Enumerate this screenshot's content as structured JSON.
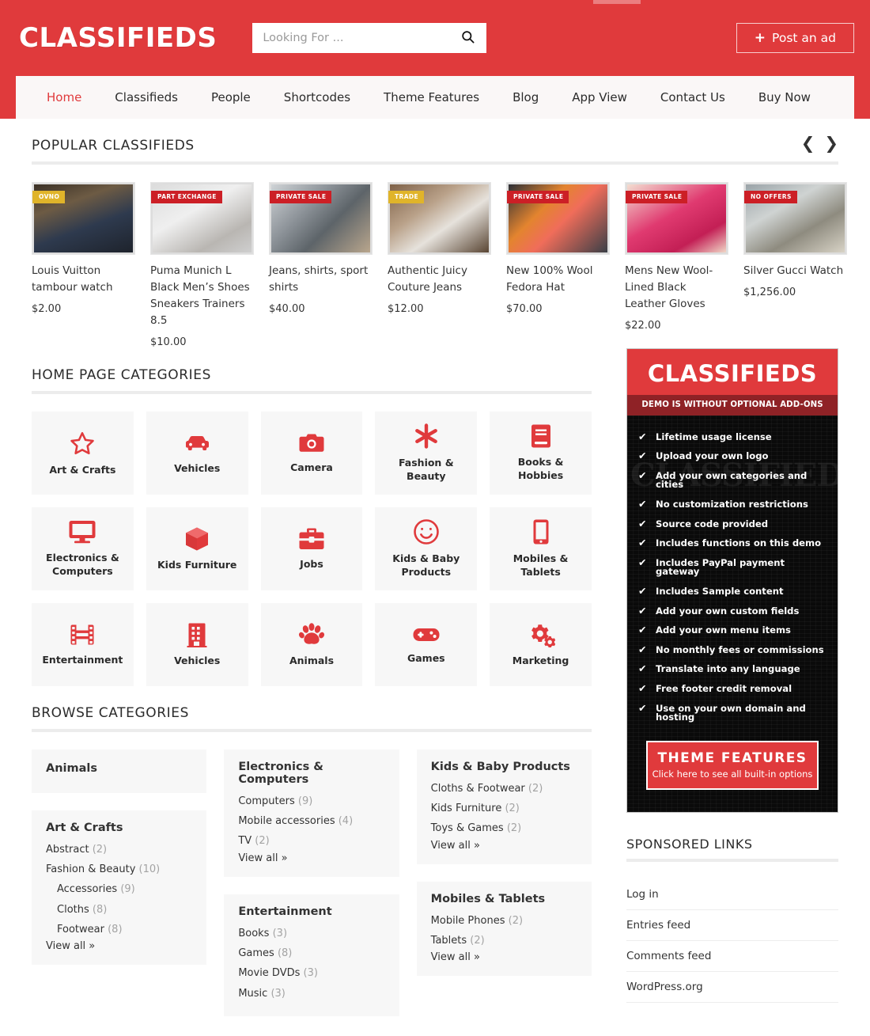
{
  "header": {
    "logo": "CLASSIFIEDS",
    "search": {
      "value": "",
      "placeholder": "Looking For ..."
    },
    "post_ad_label": "Post an ad",
    "post_ad_plus": "+",
    "accent_color": "#e03a3c"
  },
  "nav": {
    "items": [
      {
        "label": "Home",
        "active": true
      },
      {
        "label": "Classifieds",
        "active": false
      },
      {
        "label": "People",
        "active": false
      },
      {
        "label": "Shortcodes",
        "active": false
      },
      {
        "label": "Theme Features",
        "active": false
      },
      {
        "label": "Blog",
        "active": false
      },
      {
        "label": "App View",
        "active": false
      },
      {
        "label": "Contact Us",
        "active": false
      },
      {
        "label": "Buy Now",
        "active": false
      }
    ]
  },
  "popular": {
    "heading": "POPULAR CLASSIFIEDS",
    "prev_icon": "chevron-left-icon",
    "next_icon": "chevron-right-icon",
    "items": [
      {
        "badge": "OVNO",
        "badge_color": "gold",
        "title": "Louis Vuitton tambour watch",
        "price": "$2.00"
      },
      {
        "badge": "PART EXCHANGE",
        "badge_color": "red",
        "title": "Puma Munich L Black Men’s Shoes Sneakers Trainers 8.5",
        "price": "$10.00"
      },
      {
        "badge": "PRIVATE SALE",
        "badge_color": "red",
        "title": "Jeans, shirts, sport shirts",
        "price": "$40.00"
      },
      {
        "badge": "TRADE",
        "badge_color": "gold",
        "title": "Authentic Juicy Couture Jeans",
        "price": "$12.00"
      },
      {
        "badge": "PRIVATE SALE",
        "badge_color": "red",
        "title": "New 100% Wool Fedora Hat",
        "price": "$70.00"
      },
      {
        "badge": "PRIVATE SALE",
        "badge_color": "red",
        "title": "Mens New Wool-Lined Black Leather Gloves",
        "price": "$22.00"
      },
      {
        "badge": "NO OFFERS",
        "badge_color": "red",
        "title": "Silver Gucci Watch",
        "price": "$1,256.00"
      }
    ]
  },
  "home_categories": {
    "heading": "HOME PAGE CATEGORIES",
    "tiles": [
      {
        "label": "Art & Crafts",
        "icon": "star-icon"
      },
      {
        "label": "Vehicles",
        "icon": "car-icon"
      },
      {
        "label": "Camera",
        "icon": "camera-icon"
      },
      {
        "label": "Fashion & Beauty",
        "icon": "asterisk-icon"
      },
      {
        "label": "Books & Hobbies",
        "icon": "book-icon"
      },
      {
        "label": "Electronics & Computers",
        "icon": "monitor-icon"
      },
      {
        "label": "Kids Furniture",
        "icon": "box-icon"
      },
      {
        "label": "Jobs",
        "icon": "briefcase-icon"
      },
      {
        "label": "Kids & Baby Products",
        "icon": "smiley-icon"
      },
      {
        "label": "Mobiles & Tablets",
        "icon": "phone-icon"
      },
      {
        "label": "Entertainment",
        "icon": "film-icon"
      },
      {
        "label": "Vehicles",
        "icon": "building-icon"
      },
      {
        "label": "Animals",
        "icon": "paw-icon"
      },
      {
        "label": "Games",
        "icon": "gamepad-icon"
      },
      {
        "label": "Marketing",
        "icon": "gears-icon"
      }
    ]
  },
  "browse": {
    "heading": "BROWSE CATEGORIES",
    "view_all_label": "View all »",
    "columns": [
      [
        {
          "title": "Animals",
          "items": [],
          "view_all": false
        },
        {
          "title": "Art & Crafts",
          "items": [
            {
              "label": "Abstract",
              "count": "(2)",
              "level": 1
            },
            {
              "label": "Fashion & Beauty",
              "count": "(10)",
              "level": 1
            },
            {
              "label": "Accessories",
              "count": "(9)",
              "level": 2
            },
            {
              "label": "Cloths",
              "count": "(8)",
              "level": 2
            },
            {
              "label": "Footwear",
              "count": "(8)",
              "level": 2
            }
          ],
          "view_all": true
        }
      ],
      [
        {
          "title": "Electronics & Computers",
          "items": [
            {
              "label": "Computers",
              "count": "(9)",
              "level": 1
            },
            {
              "label": "Mobile accessories",
              "count": "(4)",
              "level": 1
            },
            {
              "label": "TV",
              "count": "(2)",
              "level": 1
            }
          ],
          "view_all": true
        },
        {
          "title": "Entertainment",
          "items": [
            {
              "label": "Books",
              "count": "(3)",
              "level": 1
            },
            {
              "label": "Games",
              "count": "(8)",
              "level": 1
            },
            {
              "label": "Movie DVDs",
              "count": "(3)",
              "level": 1
            },
            {
              "label": "Music",
              "count": "(3)",
              "level": 1
            }
          ],
          "view_all": false
        }
      ],
      [
        {
          "title": "Kids & Baby Products",
          "items": [
            {
              "label": "Cloths & Footwear",
              "count": "(2)",
              "level": 1
            },
            {
              "label": "Kids Furniture",
              "count": "(2)",
              "level": 1
            },
            {
              "label": "Toys & Games",
              "count": "(2)",
              "level": 1
            }
          ],
          "view_all": true
        },
        {
          "title": "Mobiles & Tablets",
          "items": [
            {
              "label": "Mobile Phones",
              "count": "(2)",
              "level": 1
            },
            {
              "label": "Tablets",
              "count": "(2)",
              "level": 1
            }
          ],
          "view_all": true
        }
      ]
    ]
  },
  "ad": {
    "logo": "CLASSIFIEDS",
    "subtitle": "DEMO IS WITHOUT OPTIONAL ADD-ONS",
    "watermark": "CLASSIFIEDS",
    "check_icon": "check-icon",
    "features": [
      "Lifetime usage license",
      "Upload your own logo",
      "Add your own categories and cities",
      "No customization restrictions",
      "Source code provided",
      "Includes functions on this demo",
      "Includes PayPal payment gateway",
      "Includes Sample content",
      "Add your own custom fields",
      "Add your own menu items",
      "No monthly fees or commissions",
      "Translate into any language",
      "Free footer credit removal",
      "Use on your own domain and hosting"
    ],
    "cta_title": "THEME FEATURES",
    "cta_sub": "Click here to see all built-in options"
  },
  "sponsored": {
    "heading": "SPONSORED LINKS",
    "links": [
      "Log in",
      "Entries feed",
      "Comments feed",
      "WordPress.org"
    ]
  }
}
